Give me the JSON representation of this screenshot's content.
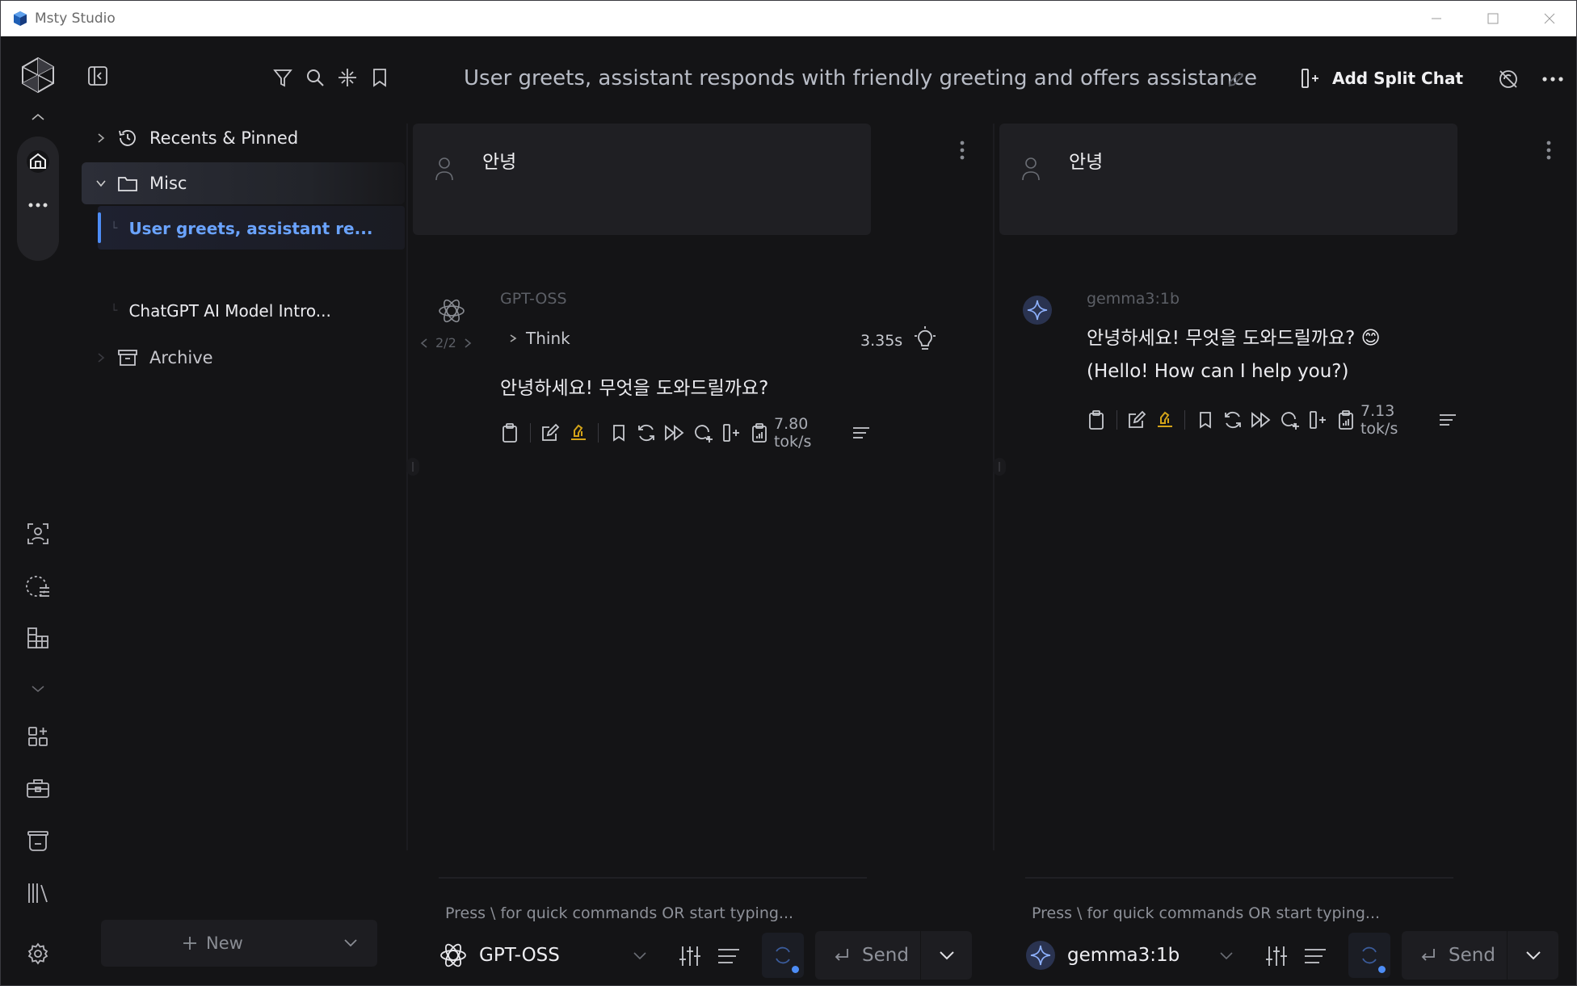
{
  "window": {
    "title": "Msty Studio"
  },
  "sidebar": {
    "recents_label": "Recents & Pinned",
    "folder_label": "Misc",
    "conversations": [
      {
        "label": "User greets, assistant re..."
      },
      {
        "label": "ChatGPT AI Model Intro..."
      }
    ],
    "archive_label": "Archive",
    "new_label": "New"
  },
  "header": {
    "title": "User greets, assistant responds with friendly greeting and offers assistance",
    "add_split_label": "Add Split Chat"
  },
  "panels": [
    {
      "user_message": "안녕",
      "model": "GPT-OSS",
      "nav": "2/2",
      "think_label": "Think",
      "think_time": "3.35s",
      "response_lines": [
        "안녕하세요! 무엇을 도와드릴까요?"
      ],
      "speed": "7.80 tok/s",
      "placeholder": "Press \\ for quick commands OR start typing...",
      "send_label": "Send"
    },
    {
      "user_message": "안녕",
      "model": "gemma3:1b",
      "response_lines": [
        "안녕하세요! 무엇을 도와드릴까요? 😊",
        "(Hello! How can I help you?)"
      ],
      "speed": "7.13 tok/s",
      "placeholder": "Press \\ for quick commands OR start typing...",
      "send_label": "Send"
    }
  ],
  "colors": {
    "accent": "#4d8df6",
    "gold": "#d4a419",
    "background": "#141416",
    "card": "#1f1f23"
  }
}
